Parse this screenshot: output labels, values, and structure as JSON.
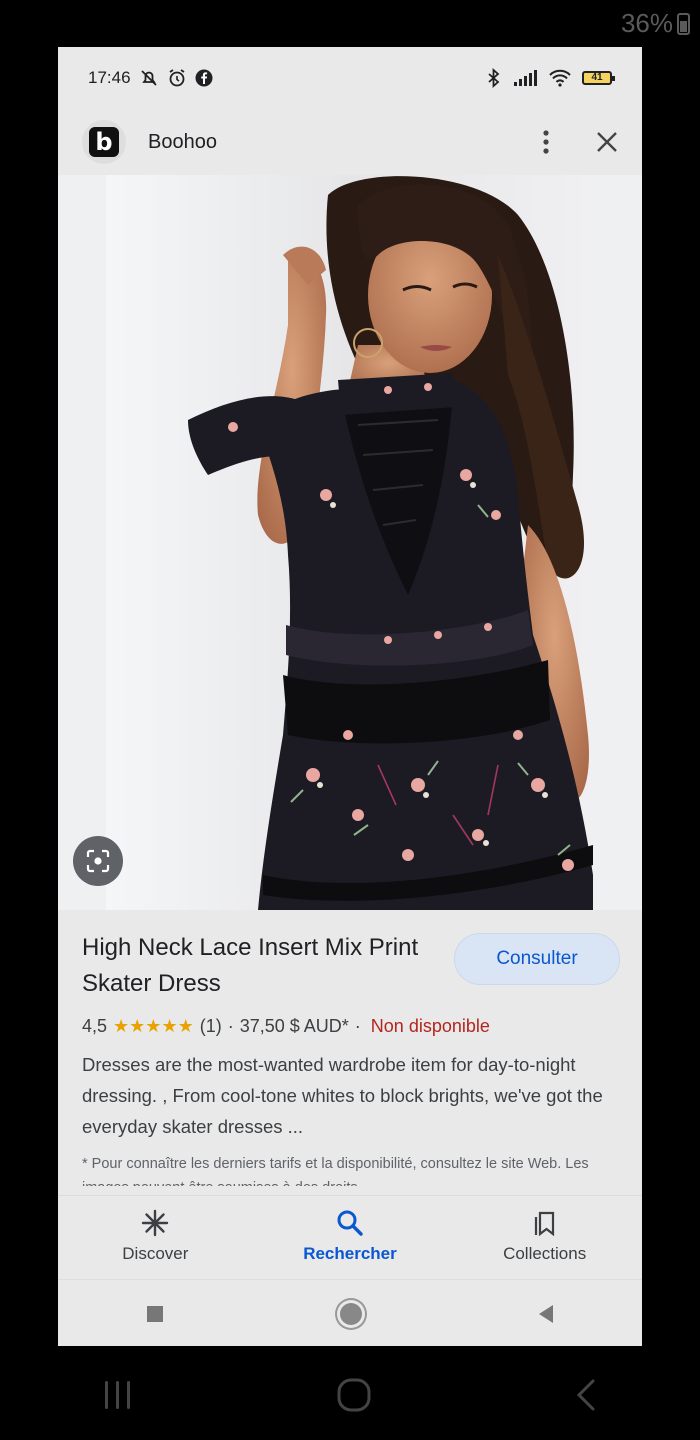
{
  "device": {
    "battery_percent": "36%"
  },
  "status_bar": {
    "time": "17:46",
    "battery_level": "41"
  },
  "app_bar": {
    "site_name": "Boohoo",
    "logo_letter": "b"
  },
  "product": {
    "title": "High Neck Lace Insert Mix Print Skater Dress",
    "cta_label": "Consulter",
    "rating": "4,5",
    "stars": "★★★★★",
    "rating_value": 4.5,
    "review_count": "(1)",
    "separator": "·",
    "price": "37,50 $ AUD*",
    "availability": "Non disponible",
    "description": "Dresses are the most-wanted wardrobe item for day-to-night dressing. , From cool-tone whites to block brights, we've got the everyday skater dresses ...",
    "footnote": "* Pour connaître les derniers tarifs et la disponibilité, consultez le site Web. Les images peuvent être soumises à des droits"
  },
  "bottom_nav": {
    "items": [
      {
        "label": "Discover",
        "icon": "asterisk-icon"
      },
      {
        "label": "Rechercher",
        "icon": "search-icon",
        "active": true
      },
      {
        "label": "Collections",
        "icon": "bookmark-icon"
      }
    ]
  },
  "colors": {
    "accent": "#0b57d0",
    "unavailable": "#b3261e",
    "star": "#e8a300"
  }
}
